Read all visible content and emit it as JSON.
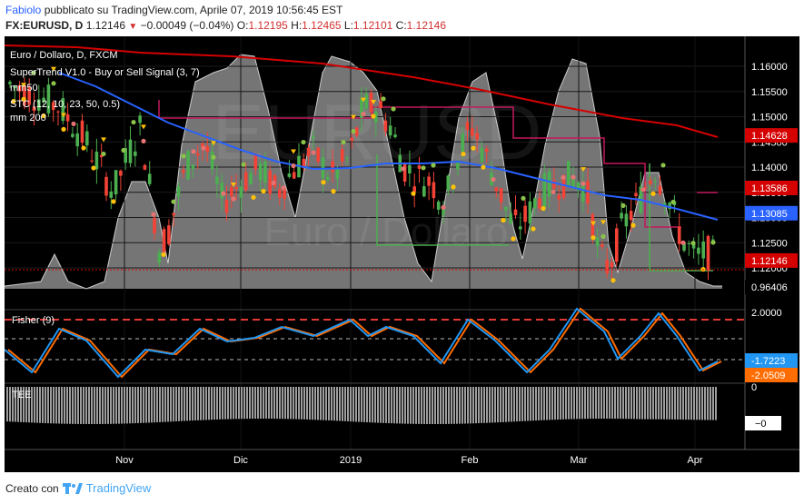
{
  "header": {
    "author": "Fabiolo",
    "published": "pubblicato su TradingView.com, Aprile 07, 2019 10:56:45 EST",
    "symbol": "FX:EURUSD, D",
    "last": "1.12146",
    "change": "−0.00049 (−0.04%)",
    "open_label": "O:",
    "open": "1.12195",
    "high_label": "H:",
    "high": "1.12465",
    "low_label": "L:",
    "low": "1.12101",
    "close_label": "C:",
    "close": "1.12146"
  },
  "legend": {
    "title": "Euro / Dollaro, D, FXCM",
    "supertrend": "SuperTrend V1.0 - Buy or Sell Signal (3, 7)",
    "mm50": "mm50",
    "stc": "STC (12, 10, 23, 50, 0.5)",
    "mm200": "mm 200",
    "watermark_symbol": "EURUSD",
    "watermark_name": "Euro / Dollaro"
  },
  "price_axis": {
    "ticks": [
      "1.16000",
      "1.15500",
      "1.15000",
      "1.14500",
      "1.14000",
      "1.13500",
      "1.13000",
      "1.12500",
      "1.12000"
    ],
    "labels": [
      {
        "text": "1.14628",
        "color": "#d50000"
      },
      {
        "text": "1.13586",
        "color": "#d50000"
      },
      {
        "text": "1.13085",
        "color": "#2962ff"
      },
      {
        "text": "1.12146",
        "color": "#d50000"
      },
      {
        "text": "0.96406",
        "color": "#ffffff"
      }
    ]
  },
  "fisher": {
    "title": "Fisher (9)",
    "ticks": [
      "2.0000"
    ],
    "labels": [
      {
        "text": "-1.7223",
        "color": "#2196f3"
      },
      {
        "text": "-2.0509",
        "color": "#ff6d00"
      }
    ],
    "level_values": [
      2.0,
      -2.0
    ],
    "series": [
      {
        "name": "Fisher",
        "color": "#2196f3"
      },
      {
        "name": "Trigger",
        "color": "#ff6d00"
      }
    ]
  },
  "tee": {
    "title": "TEE",
    "ticks": [
      "0",
      "−0"
    ]
  },
  "time_axis": {
    "labels": [
      "Nov",
      "Dic",
      "2019",
      "Feb",
      "Mar",
      "Apr"
    ]
  },
  "footer": {
    "created_with": "Creato con",
    "brand": "TradingView"
  },
  "colors": {
    "up": "#4caf50",
    "down": "#f44336",
    "ma50": "#2962ff",
    "ma200": "#d50000",
    "stc_fill": "#8a8a8a",
    "supertrend_sell": "#c2185b",
    "supertrend_buy": "#4caf50",
    "buy_dot": "#8bc34a",
    "sell_dot": "#ffc107"
  }
}
